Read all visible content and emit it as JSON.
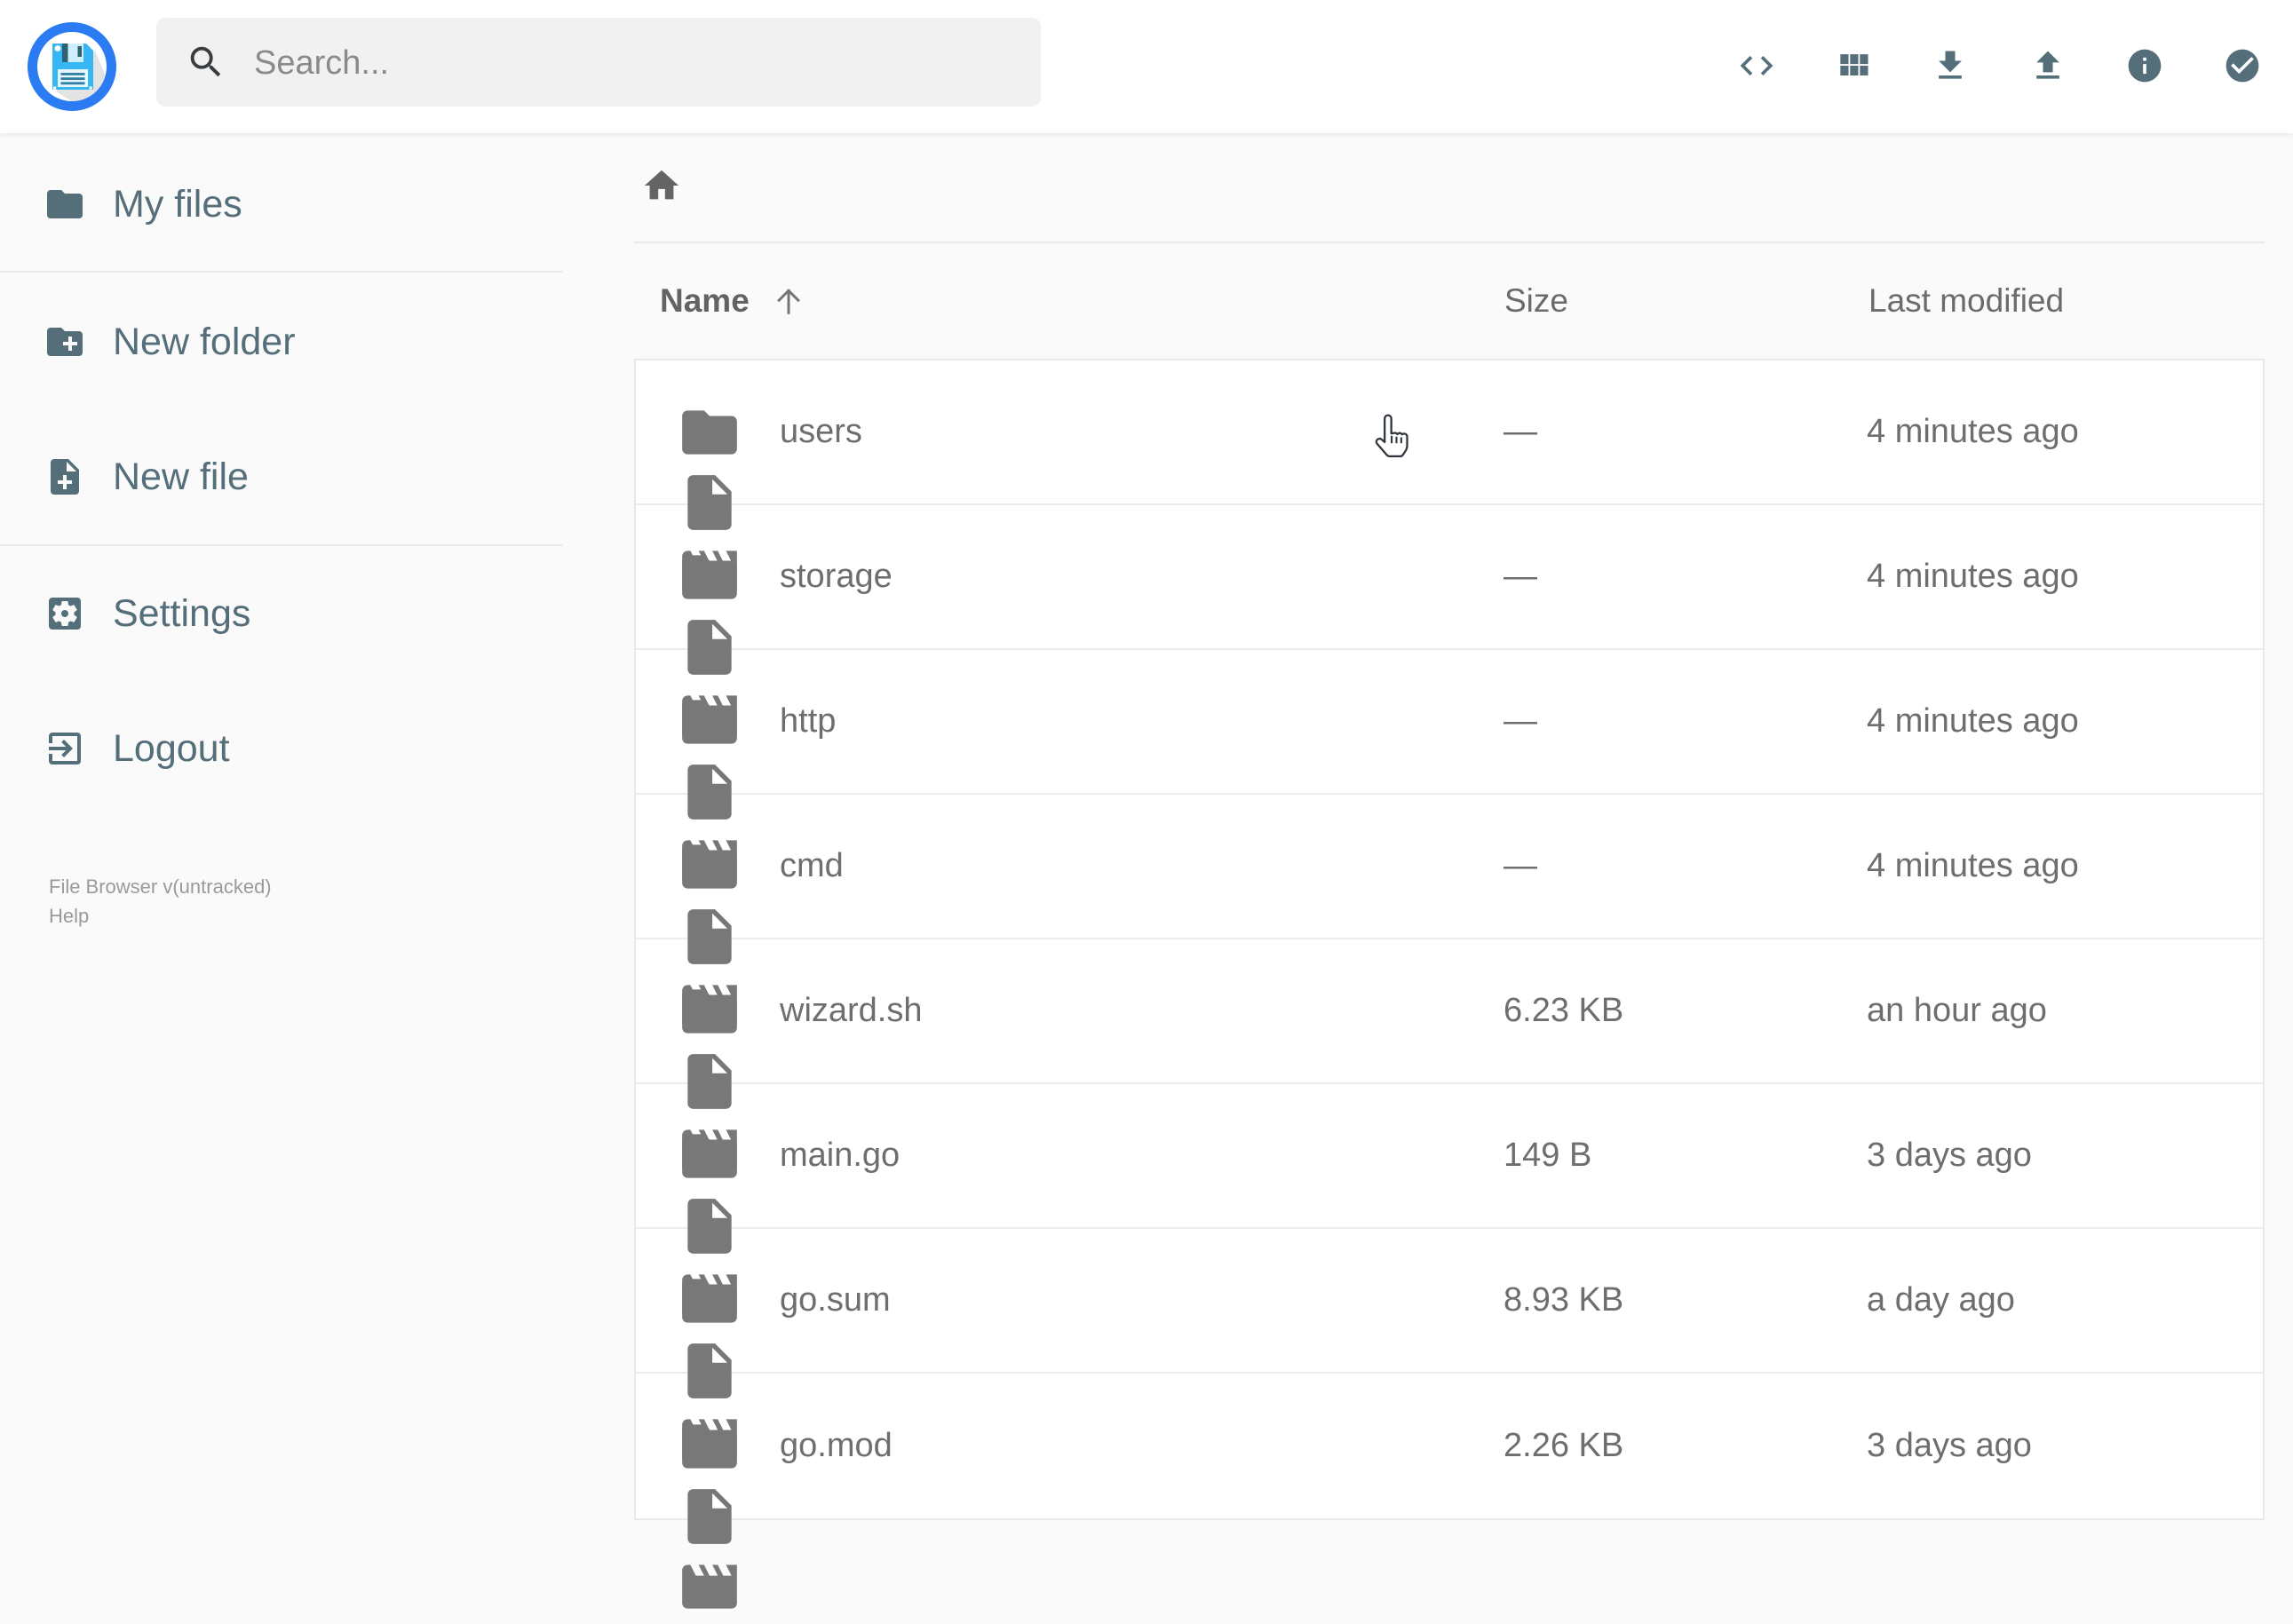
{
  "app": {
    "name": "File Browser",
    "version_label": "File Browser v(untracked)",
    "help_label": "Help"
  },
  "header": {
    "logo_icon": "floppy-disk-logo",
    "search": {
      "placeholder": "Search...",
      "icon": "search-icon",
      "value": ""
    },
    "actions": [
      {
        "icon": "code-icon"
      },
      {
        "icon": "grid-view-icon"
      },
      {
        "icon": "download-icon"
      },
      {
        "icon": "upload-icon"
      },
      {
        "icon": "info-icon"
      },
      {
        "icon": "check-circle-icon"
      }
    ]
  },
  "sidebar": {
    "items": [
      {
        "label": "My files",
        "icon": "folder-icon"
      },
      {
        "label": "New folder",
        "icon": "folder-plus-icon"
      },
      {
        "label": "New file",
        "icon": "file-plus-icon"
      },
      {
        "label": "Settings",
        "icon": "gear-icon"
      },
      {
        "label": "Logout",
        "icon": "logout-icon"
      }
    ],
    "footer": {
      "version": "File Browser v(untracked)",
      "help": "Help"
    }
  },
  "breadcrumb": {
    "home_icon": "home-icon"
  },
  "listing": {
    "columns": [
      {
        "key": "name",
        "label": "Name",
        "sorted": "asc"
      },
      {
        "key": "size",
        "label": "Size"
      },
      {
        "key": "modified",
        "label": "Last modified"
      }
    ],
    "rows": [
      {
        "name": "users",
        "icon": "folder",
        "size": "—",
        "modified": "4 minutes ago"
      },
      {
        "name": "storage",
        "icon": "folder",
        "size": "—",
        "modified": "4 minutes ago"
      },
      {
        "name": "http",
        "icon": "folder",
        "size": "—",
        "modified": "4 minutes ago"
      },
      {
        "name": "cmd",
        "icon": "folder",
        "size": "—",
        "modified": "4 minutes ago"
      },
      {
        "name": "wizard.sh",
        "icon": "file",
        "size": "6.23 KB",
        "modified": "an hour ago"
      },
      {
        "name": "main.go",
        "icon": "file",
        "size": "149 B",
        "modified": "3 days ago"
      },
      {
        "name": "go.sum",
        "icon": "file",
        "size": "8.93 KB",
        "modified": "a day ago"
      },
      {
        "name": "go.mod",
        "icon": "movie",
        "size": "2.26 KB",
        "modified": "3 days ago"
      }
    ]
  },
  "colors": {
    "accent_blue": "#2b7bf3",
    "floppy_blue": "#36b7f3",
    "slate": "#546e7a",
    "icon_gray": "#787878",
    "text_gray": "#6e6e6e",
    "border": "#e9e9e9",
    "background": "#fafafa"
  }
}
